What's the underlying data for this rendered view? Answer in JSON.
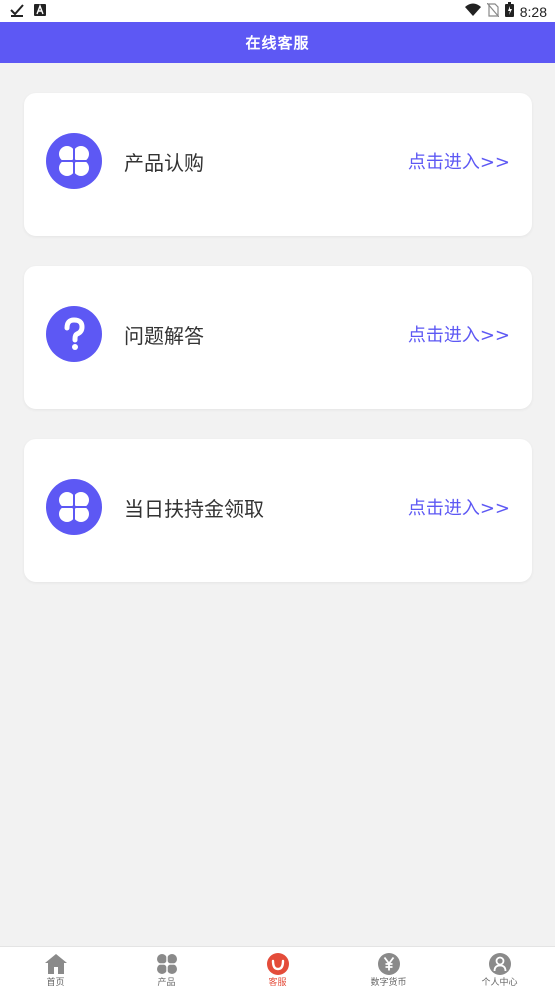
{
  "status_bar": {
    "time": "8:28",
    "left_icons": [
      "check-download-icon",
      "a-badge-icon"
    ],
    "right_icons": [
      "wifi-icon",
      "no-sim-icon",
      "battery-icon"
    ]
  },
  "header": {
    "title": "在线客服"
  },
  "cards": [
    {
      "label": "产品认购",
      "action": "点击进入>>",
      "icon": "clover-icon"
    },
    {
      "label": "问题解答",
      "action": "点击进入>>",
      "icon": "question-icon"
    },
    {
      "label": "当日扶持金领取",
      "action": "点击进入>>",
      "icon": "clover-icon"
    }
  ],
  "bottom_nav": {
    "active_index": 2,
    "items": [
      {
        "label": "首页",
        "icon": "home-icon"
      },
      {
        "label": "产品",
        "icon": "clover-icon"
      },
      {
        "label": "客服",
        "icon": "smile-service-icon"
      },
      {
        "label": "数字货币",
        "icon": "yen-coin-icon"
      },
      {
        "label": "个人中心",
        "icon": "user-icon"
      }
    ]
  },
  "colors": {
    "accent": "#5d58f4",
    "background": "#f2f2f2",
    "active_nav": "#e44c3a"
  }
}
